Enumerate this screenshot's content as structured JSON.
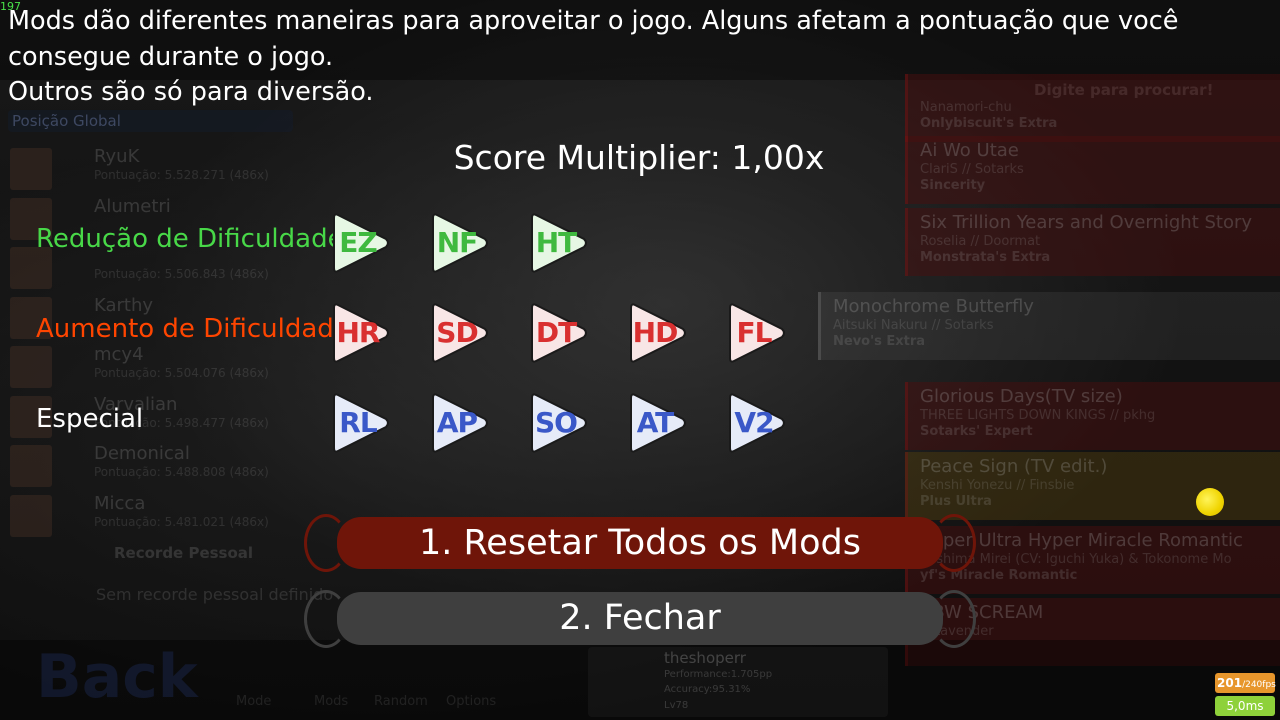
{
  "fps_counter": "197",
  "background": {
    "rank_select": "Posição Global",
    "search_hint": "Digite para procurar!",
    "leaderboard": [
      {
        "name": "RyuK",
        "score": "Pontuação: 5.528.271 (486x)"
      },
      {
        "name": "Alumetri",
        "score": ""
      },
      {
        "name": "",
        "score": "Pontuação: 5.506.843 (486x)"
      },
      {
        "name": "Karthy",
        "score": ""
      },
      {
        "name": "mcy4",
        "score": "Pontuação: 5.504.076 (486x)"
      },
      {
        "name": "Varvalian",
        "score": "Pontuação: 5.498.477 (486x)"
      },
      {
        "name": "Demonical",
        "score": "Pontuação: 5.488.808 (486x)"
      },
      {
        "name": "Micca",
        "score": "Pontuação: 5.481.021 (486x)"
      }
    ],
    "personal_best_label": "Recorde Pessoal",
    "no_personal_best": "Sem recorde pessoal definido",
    "songs": [
      {
        "title": "",
        "artist": "Nanamori-chu",
        "difficulty": "Onlybiscuit's Extra",
        "style": "red"
      },
      {
        "title": "Ai Wo Utae",
        "artist": "ClariS // Sotarks",
        "difficulty": "Sincerity",
        "style": "red"
      },
      {
        "title": "Six Trillion Years and Overnight Story",
        "artist": "Roselia // Doormat",
        "difficulty": "Monstrata's Extra",
        "style": "red"
      },
      {
        "title": "Monochrome Butterfly",
        "artist": "Aitsuki Nakuru // Sotarks",
        "difficulty": "Nevo's Extra",
        "style": "selected"
      },
      {
        "title": "Glorious Days(TV size)",
        "artist": "THREE LIGHTS DOWN KINGS // pkhg",
        "difficulty": "Sotarks' Expert",
        "style": "red"
      },
      {
        "title": "Peace Sign (TV edit.)",
        "artist": "Kenshi Yonezu // Finsbie",
        "difficulty": "Plus Ultra",
        "style": "gold"
      },
      {
        "title": "Super Ultra Hyper Miracle Romantic",
        "artist": "Kashima Mirei (CV: Iguchi Yuka) & Tokonome Mo",
        "difficulty": "yf's Miracle Romantic",
        "style": "red"
      },
      {
        "title": "BBW SCREAM",
        "artist": "// Lavender",
        "difficulty": "",
        "style": "red"
      }
    ],
    "back_label": "Back",
    "nav_labels": [
      "Mode",
      "Mods",
      "Random",
      "Options"
    ],
    "player": {
      "name": "theshoperr",
      "performance": "Performance:1.705pp",
      "accuracy": "Accuracy:95.31%",
      "level": "Lv78"
    }
  },
  "overlay": {
    "description": [
      "Mods dão diferentes maneiras para aproveitar o jogo. Alguns afetam a pontuação que você",
      "consegue durante o jogo.",
      "Outros são só para diversão."
    ],
    "score_multiplier": "Score Multiplier: 1,00x",
    "categories": [
      {
        "label": "Redução de Dificuldade",
        "color": "#48d848",
        "text_color": "#3fb93f",
        "fill": "#e6f7e4",
        "mods": [
          "EZ",
          "NF",
          "HT"
        ]
      },
      {
        "label": "Aumento de Dificuldade",
        "color": "#ff4500",
        "text_color": "#d93030",
        "fill": "#f8e6e6",
        "mods": [
          "HR",
          "SD",
          "DT",
          "HD",
          "FL"
        ]
      },
      {
        "label": "Especial",
        "color": "#ffffff",
        "text_color": "#3a58c8",
        "fill": "#e6ebf8",
        "mods": [
          "RL",
          "AP",
          "SO",
          "AT",
          "V2"
        ]
      }
    ],
    "reset_button": "1. Resetar Todos os Mods",
    "close_button": "2. Fechar"
  },
  "stats": {
    "fps": "201",
    "fps_unit": "/240fps",
    "frame_time": "5,0ms"
  }
}
